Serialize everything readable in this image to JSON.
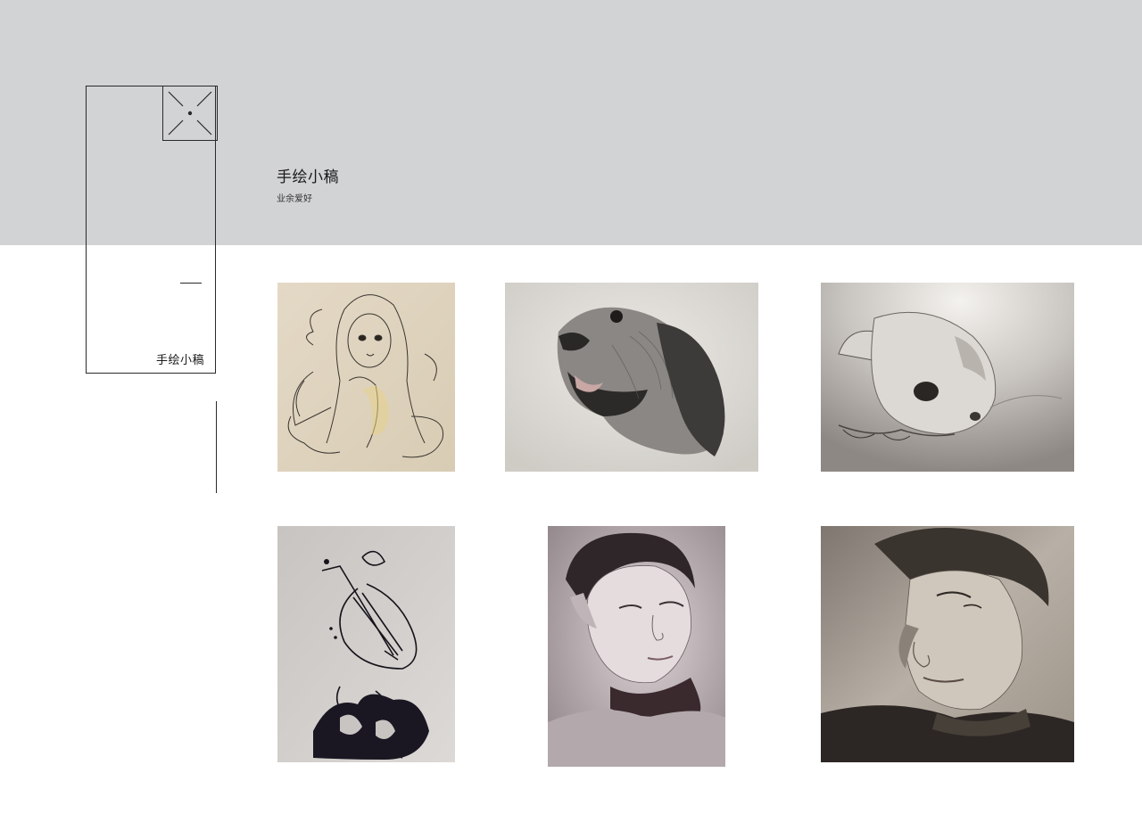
{
  "header": {
    "title": "手绘小稿",
    "subtitle": "业余爱好"
  },
  "sidebar": {
    "label": "手绘小稿",
    "logo_icon": "x-mark-icon"
  },
  "gallery": {
    "items": [
      {
        "icon": "angel-girl-sketch"
      },
      {
        "icon": "dog-pencil-sketch"
      },
      {
        "icon": "chihuahua-pencil-sketch"
      },
      {
        "icon": "pipa-ink-drawing"
      },
      {
        "icon": "boy-portrait-sketch"
      },
      {
        "icon": "man-portrait-sketch"
      }
    ]
  },
  "colors": {
    "band": "#d2d3d5",
    "line": "#2a2a2a",
    "background": "#ffffff"
  }
}
